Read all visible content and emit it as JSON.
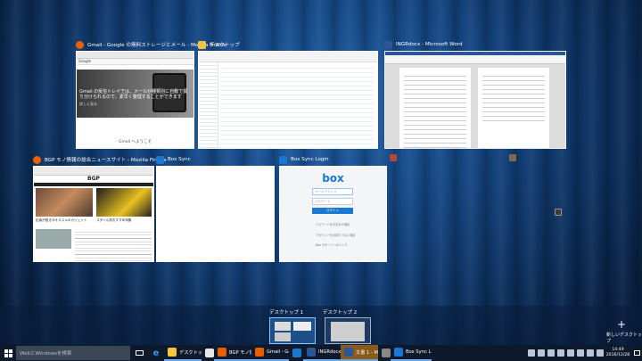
{
  "windows": [
    {
      "title": "Gmail - Google の無料ストレージとメール - Mozilla Firefox",
      "icon_color": "#e66000",
      "page_heading": "Gmail の受信トレイでは、メールが種類別に自動で振り分けられるので、素早く整理することができます",
      "page_link": "詳しく見る",
      "page_footer": "Gmail へようこそ",
      "brand": "Google"
    },
    {
      "title": "デスクトップ",
      "icon_color": "#f4c542"
    },
    {
      "title": "lNGRdocx - Microsoft Word",
      "icon_color": "#2b5797"
    },
    {
      "title": "BGP モノ情報の総合ニュースサイト - Mozilla Firefox",
      "icon_color": "#e66000",
      "site_logo": "BGP",
      "headline_1": "記者が語る今オススメのガジェット",
      "headline_2": "スタイル別おすすめ特集"
    },
    {
      "title": "Box Sync",
      "icon_color": "#1a77d2"
    },
    {
      "title": "Box Sync Login",
      "icon_color": "#1a77d2",
      "logo": "box",
      "email_placeholder": "メールアドレス",
      "password_placeholder": "パスワード",
      "login_button": "ログイン",
      "link_1": "パスワードをお忘れの場合",
      "link_2": "アカウントをお持ちでない場合",
      "link_3": "Box サポートへのリンク"
    }
  ],
  "virtual_desktops": [
    {
      "label": "デスクトップ 1"
    },
    {
      "label": "デスクトップ 2"
    }
  ],
  "new_desktop": {
    "label": "新しいデスクトップ",
    "icon": "plus-icon"
  },
  "taskbar": {
    "search_placeholder": "WebとWindowsを検索",
    "apps": [
      {
        "label": "デスクトップ",
        "color": "#f4c542"
      },
      {
        "label": "",
        "color": "#e8e8e8"
      },
      {
        "label": "BGP モノ情...",
        "color": "#e66000"
      },
      {
        "label": "Gmail - Go...",
        "color": "#e66000"
      },
      {
        "label": "",
        "color": "#1a77d2"
      },
      {
        "label": "lNGRdocx ...",
        "color": "#2b5797"
      },
      {
        "label": "文書 1 - Mic...",
        "color": "#2b5797"
      },
      {
        "label": "",
        "color": "#888888"
      },
      {
        "label": "Box Sync L...",
        "color": "#1a77d2"
      }
    ],
    "time": "14:49",
    "date": "2016/12/28"
  }
}
